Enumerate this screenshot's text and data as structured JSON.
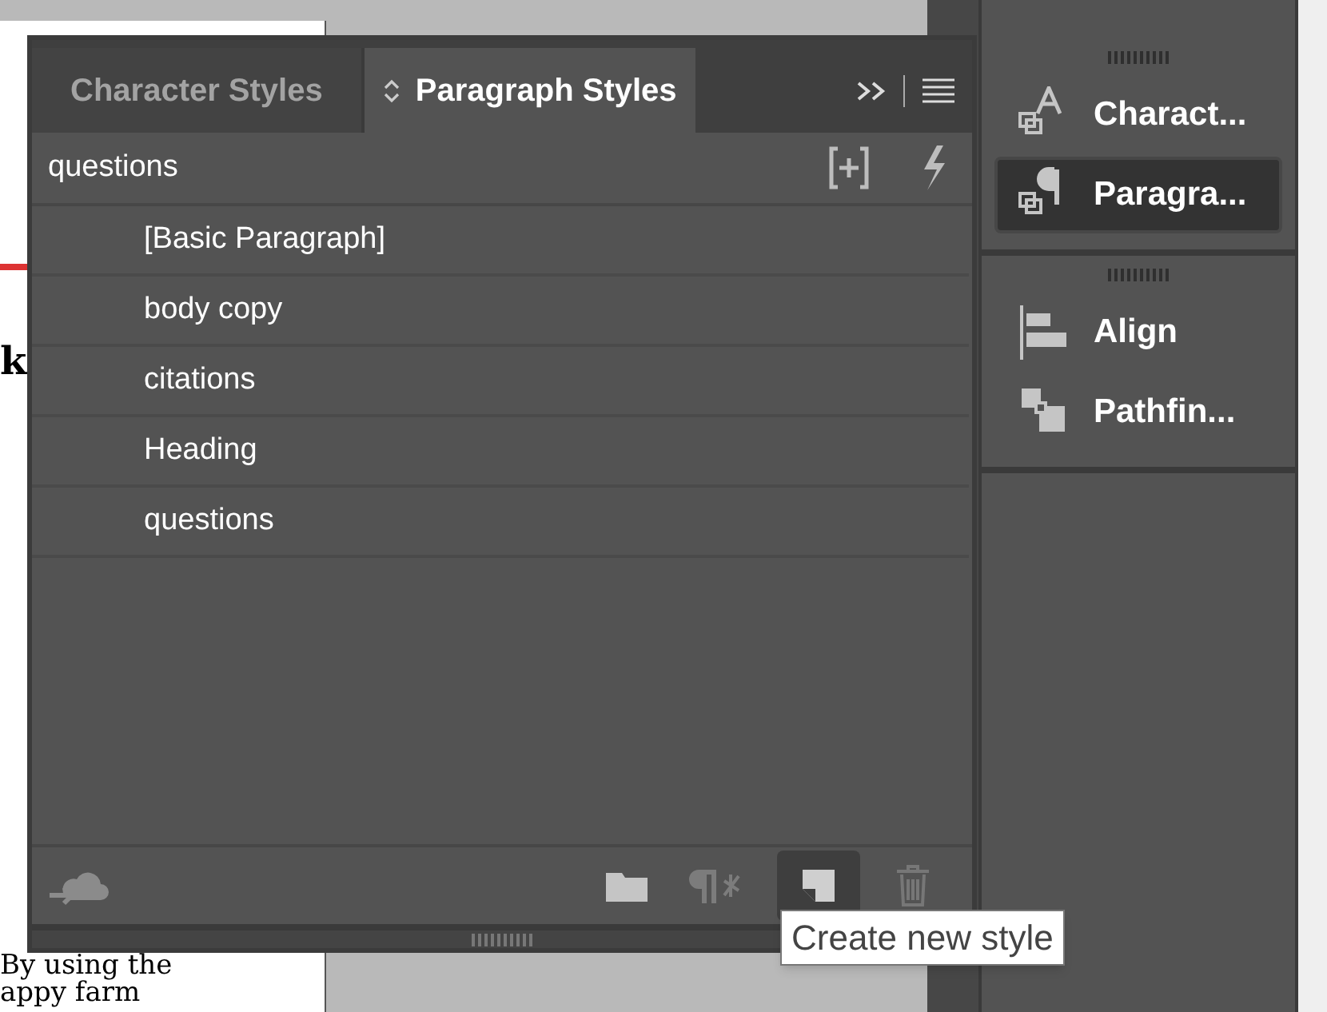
{
  "document": {
    "lines": [
      {
        "text": "k",
        "bold": true
      },
      {
        "text": "By using the",
        "bold": false
      },
      {
        "text": "appy farm",
        "bold": false
      }
    ]
  },
  "panel": {
    "tabs": [
      {
        "label": "Character Styles",
        "selected": false
      },
      {
        "label": "Paragraph Styles",
        "selected": true
      }
    ],
    "current_style": "questions",
    "styles": [
      {
        "label": "[Basic Paragraph]",
        "selected": false
      },
      {
        "label": "body copy",
        "selected": false
      },
      {
        "label": "citations",
        "selected": false
      },
      {
        "label": "Heading",
        "selected": false
      },
      {
        "label": "questions",
        "selected": false
      }
    ],
    "tooltip": "Create new style"
  },
  "dock": {
    "groups": [
      [
        {
          "label": "Charact...",
          "selected": false
        },
        {
          "label": "Paragra...",
          "selected": true
        }
      ],
      [
        {
          "label": "Align",
          "selected": false
        },
        {
          "label": "Pathfin...",
          "selected": false
        }
      ]
    ]
  }
}
